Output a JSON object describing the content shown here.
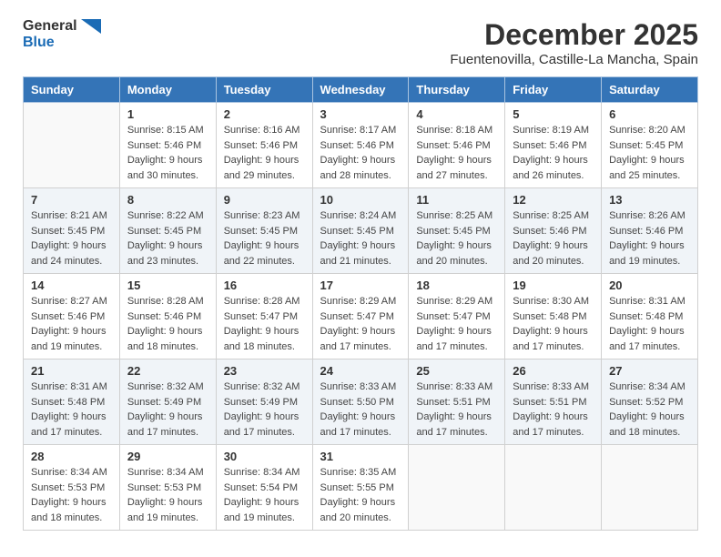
{
  "logo": {
    "general": "General",
    "blue": "Blue"
  },
  "title": "December 2025",
  "subtitle": "Fuentenovilla, Castille-La Mancha, Spain",
  "weekdays": [
    "Sunday",
    "Monday",
    "Tuesday",
    "Wednesday",
    "Thursday",
    "Friday",
    "Saturday"
  ],
  "weeks": [
    [
      {
        "day": "",
        "sunrise": "",
        "sunset": "",
        "daylight": ""
      },
      {
        "day": "1",
        "sunrise": "Sunrise: 8:15 AM",
        "sunset": "Sunset: 5:46 PM",
        "daylight": "Daylight: 9 hours and 30 minutes."
      },
      {
        "day": "2",
        "sunrise": "Sunrise: 8:16 AM",
        "sunset": "Sunset: 5:46 PM",
        "daylight": "Daylight: 9 hours and 29 minutes."
      },
      {
        "day": "3",
        "sunrise": "Sunrise: 8:17 AM",
        "sunset": "Sunset: 5:46 PM",
        "daylight": "Daylight: 9 hours and 28 minutes."
      },
      {
        "day": "4",
        "sunrise": "Sunrise: 8:18 AM",
        "sunset": "Sunset: 5:46 PM",
        "daylight": "Daylight: 9 hours and 27 minutes."
      },
      {
        "day": "5",
        "sunrise": "Sunrise: 8:19 AM",
        "sunset": "Sunset: 5:46 PM",
        "daylight": "Daylight: 9 hours and 26 minutes."
      },
      {
        "day": "6",
        "sunrise": "Sunrise: 8:20 AM",
        "sunset": "Sunset: 5:45 PM",
        "daylight": "Daylight: 9 hours and 25 minutes."
      }
    ],
    [
      {
        "day": "7",
        "sunrise": "Sunrise: 8:21 AM",
        "sunset": "Sunset: 5:45 PM",
        "daylight": "Daylight: 9 hours and 24 minutes."
      },
      {
        "day": "8",
        "sunrise": "Sunrise: 8:22 AM",
        "sunset": "Sunset: 5:45 PM",
        "daylight": "Daylight: 9 hours and 23 minutes."
      },
      {
        "day": "9",
        "sunrise": "Sunrise: 8:23 AM",
        "sunset": "Sunset: 5:45 PM",
        "daylight": "Daylight: 9 hours and 22 minutes."
      },
      {
        "day": "10",
        "sunrise": "Sunrise: 8:24 AM",
        "sunset": "Sunset: 5:45 PM",
        "daylight": "Daylight: 9 hours and 21 minutes."
      },
      {
        "day": "11",
        "sunrise": "Sunrise: 8:25 AM",
        "sunset": "Sunset: 5:45 PM",
        "daylight": "Daylight: 9 hours and 20 minutes."
      },
      {
        "day": "12",
        "sunrise": "Sunrise: 8:25 AM",
        "sunset": "Sunset: 5:46 PM",
        "daylight": "Daylight: 9 hours and 20 minutes."
      },
      {
        "day": "13",
        "sunrise": "Sunrise: 8:26 AM",
        "sunset": "Sunset: 5:46 PM",
        "daylight": "Daylight: 9 hours and 19 minutes."
      }
    ],
    [
      {
        "day": "14",
        "sunrise": "Sunrise: 8:27 AM",
        "sunset": "Sunset: 5:46 PM",
        "daylight": "Daylight: 9 hours and 19 minutes."
      },
      {
        "day": "15",
        "sunrise": "Sunrise: 8:28 AM",
        "sunset": "Sunset: 5:46 PM",
        "daylight": "Daylight: 9 hours and 18 minutes."
      },
      {
        "day": "16",
        "sunrise": "Sunrise: 8:28 AM",
        "sunset": "Sunset: 5:47 PM",
        "daylight": "Daylight: 9 hours and 18 minutes."
      },
      {
        "day": "17",
        "sunrise": "Sunrise: 8:29 AM",
        "sunset": "Sunset: 5:47 PM",
        "daylight": "Daylight: 9 hours and 17 minutes."
      },
      {
        "day": "18",
        "sunrise": "Sunrise: 8:29 AM",
        "sunset": "Sunset: 5:47 PM",
        "daylight": "Daylight: 9 hours and 17 minutes."
      },
      {
        "day": "19",
        "sunrise": "Sunrise: 8:30 AM",
        "sunset": "Sunset: 5:48 PM",
        "daylight": "Daylight: 9 hours and 17 minutes."
      },
      {
        "day": "20",
        "sunrise": "Sunrise: 8:31 AM",
        "sunset": "Sunset: 5:48 PM",
        "daylight": "Daylight: 9 hours and 17 minutes."
      }
    ],
    [
      {
        "day": "21",
        "sunrise": "Sunrise: 8:31 AM",
        "sunset": "Sunset: 5:48 PM",
        "daylight": "Daylight: 9 hours and 17 minutes."
      },
      {
        "day": "22",
        "sunrise": "Sunrise: 8:32 AM",
        "sunset": "Sunset: 5:49 PM",
        "daylight": "Daylight: 9 hours and 17 minutes."
      },
      {
        "day": "23",
        "sunrise": "Sunrise: 8:32 AM",
        "sunset": "Sunset: 5:49 PM",
        "daylight": "Daylight: 9 hours and 17 minutes."
      },
      {
        "day": "24",
        "sunrise": "Sunrise: 8:33 AM",
        "sunset": "Sunset: 5:50 PM",
        "daylight": "Daylight: 9 hours and 17 minutes."
      },
      {
        "day": "25",
        "sunrise": "Sunrise: 8:33 AM",
        "sunset": "Sunset: 5:51 PM",
        "daylight": "Daylight: 9 hours and 17 minutes."
      },
      {
        "day": "26",
        "sunrise": "Sunrise: 8:33 AM",
        "sunset": "Sunset: 5:51 PM",
        "daylight": "Daylight: 9 hours and 17 minutes."
      },
      {
        "day": "27",
        "sunrise": "Sunrise: 8:34 AM",
        "sunset": "Sunset: 5:52 PM",
        "daylight": "Daylight: 9 hours and 18 minutes."
      }
    ],
    [
      {
        "day": "28",
        "sunrise": "Sunrise: 8:34 AM",
        "sunset": "Sunset: 5:53 PM",
        "daylight": "Daylight: 9 hours and 18 minutes."
      },
      {
        "day": "29",
        "sunrise": "Sunrise: 8:34 AM",
        "sunset": "Sunset: 5:53 PM",
        "daylight": "Daylight: 9 hours and 19 minutes."
      },
      {
        "day": "30",
        "sunrise": "Sunrise: 8:34 AM",
        "sunset": "Sunset: 5:54 PM",
        "daylight": "Daylight: 9 hours and 19 minutes."
      },
      {
        "day": "31",
        "sunrise": "Sunrise: 8:35 AM",
        "sunset": "Sunset: 5:55 PM",
        "daylight": "Daylight: 9 hours and 20 minutes."
      },
      {
        "day": "",
        "sunrise": "",
        "sunset": "",
        "daylight": ""
      },
      {
        "day": "",
        "sunrise": "",
        "sunset": "",
        "daylight": ""
      },
      {
        "day": "",
        "sunrise": "",
        "sunset": "",
        "daylight": ""
      }
    ]
  ]
}
